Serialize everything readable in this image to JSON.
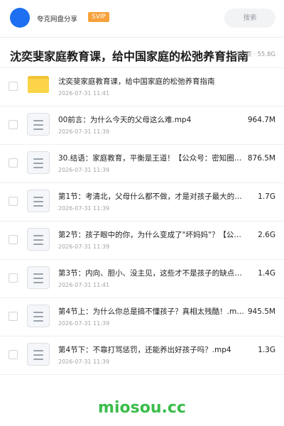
{
  "header": {
    "share_name": "夸克网盘分享",
    "badge": "SVIP",
    "search_placeholder": "搜索"
  },
  "title": "沈奕斐家庭教育课，给中国家庭的松弛养育指南",
  "count_info": "37 项 · 55.8G",
  "files": [
    {
      "type": "folder",
      "name": "沈奕斐家庭教育课，给中国家庭的松弛养育指南",
      "date": "2026-07-31 11:41",
      "size": ""
    },
    {
      "type": "file",
      "name": "00前言：为什么今天的父母这么难.mp4",
      "date": "2026-07-31 11:39",
      "size": "964.7M"
    },
    {
      "type": "file",
      "name": "30.结语：家庭教育，平衡是王道！【公众号：密知圈…",
      "date": "2026-07-31 11:39",
      "size": "876.5M"
    },
    {
      "type": "file",
      "name": "第1节：考清北，父母什么都不做，才是对孩子最大的帮…",
      "date": "2026-07-31 11:39",
      "size": "1.7G"
    },
    {
      "type": "file",
      "name": "第2节：孩子眼中的你，为什么变成了\"坏妈妈\"？【公…",
      "date": "2026-07-31 11:39",
      "size": "2.6G"
    },
    {
      "type": "file",
      "name": "第3节：内向、胆小、没主见，这些才不是孩子的缺点！…",
      "date": "2026-07-31 11:41",
      "size": "1.4G"
    },
    {
      "type": "file",
      "name": "第4节上：为什么你总是搞不懂孩子？真相太残酷！.m…",
      "date": "2026-07-31 11:39",
      "size": "945.5M"
    },
    {
      "type": "file",
      "name": "第4节下：不靠打骂惩罚，还能养出好孩子吗？.mp4",
      "date": "2026-07-31 11:39",
      "size": "1.3G"
    }
  ],
  "watermark": "miosou.cc",
  "colors": {
    "avatar": "#1e6ff1",
    "badge": "#f6a13a",
    "folder": "#fbd448",
    "watermark": "#3bbd4a"
  }
}
